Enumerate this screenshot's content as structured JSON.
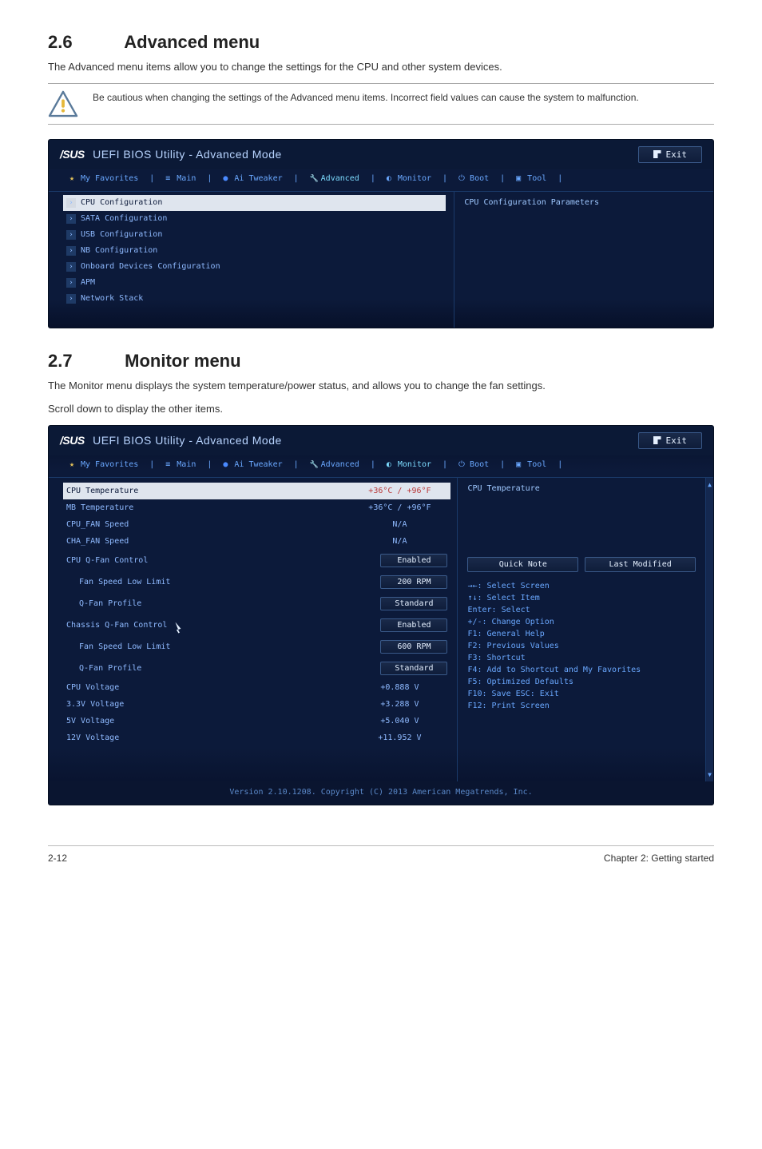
{
  "sections": {
    "advanced": {
      "num": "2.6",
      "title": "Advanced menu",
      "desc": "The Advanced menu items allow you to change the settings for the CPU and other system devices.",
      "caution": "Be cautious when changing the settings of the Advanced menu items. Incorrect field values can cause the system to malfunction."
    },
    "monitor": {
      "num": "2.7",
      "title": "Monitor menu",
      "desc": "The Monitor menu displays the system temperature/power status, and allows you to change the fan settings.",
      "scroll_hint": "Scroll down to display the other items."
    }
  },
  "bios": {
    "brand": "/SUS",
    "title": "UEFI BIOS Utility - Advanced Mode",
    "exit_label": "Exit",
    "tabs": [
      "My Favorites",
      "Main",
      "Ai Tweaker",
      "Advanced",
      "Monitor",
      "Boot",
      "Tool"
    ]
  },
  "advanced_panel": {
    "items": [
      "CPU Configuration",
      "SATA Configuration",
      "USB Configuration",
      "NB Configuration",
      "Onboard Devices Configuration",
      "APM",
      "Network Stack"
    ],
    "help": "CPU Configuration Parameters"
  },
  "monitor_panel": {
    "rows": [
      {
        "label": "CPU Temperature",
        "value": "+36°C / +96°F",
        "type": "sel"
      },
      {
        "label": "MB Temperature",
        "value": "+36°C / +96°F",
        "type": "text"
      },
      {
        "label": "CPU_FAN Speed",
        "value": "N/A",
        "type": "text"
      },
      {
        "label": "CHA_FAN Speed",
        "value": "N/A",
        "type": "text"
      },
      {
        "label": "CPU Q-Fan Control",
        "value": "Enabled",
        "type": "btn"
      },
      {
        "label": "Fan Speed Low Limit",
        "value": "200 RPM",
        "type": "btn",
        "indent": true
      },
      {
        "label": "Q-Fan Profile",
        "value": "Standard",
        "type": "btn",
        "indent": true
      },
      {
        "label": "Chassis Q-Fan Control",
        "value": "Enabled",
        "type": "btn",
        "cursor": true
      },
      {
        "label": "Fan Speed Low Limit",
        "value": "600 RPM",
        "type": "btn",
        "indent": true
      },
      {
        "label": "Q-Fan Profile",
        "value": "Standard",
        "type": "btn",
        "indent": true
      },
      {
        "label": "CPU Voltage",
        "value": "+0.888 V",
        "type": "text"
      },
      {
        "label": "3.3V Voltage",
        "value": "+3.288 V",
        "type": "text"
      },
      {
        "label": "5V Voltage",
        "value": "+5.040 V",
        "type": "text"
      },
      {
        "label": "12V Voltage",
        "value": "+11.952 V",
        "type": "text"
      }
    ],
    "right_heading": "CPU Temperature",
    "right_buttons": [
      "Quick Note",
      "Last Modified"
    ],
    "help_lines": [
      "→←: Select Screen",
      "↑↓: Select Item",
      "Enter: Select",
      "+/-: Change Option",
      "F1: General Help",
      "F2: Previous Values",
      "F3: Shortcut",
      "F4: Add to Shortcut and My Favorites",
      "F5: Optimized Defaults",
      "F10: Save  ESC: Exit",
      "F12: Print Screen"
    ],
    "version": "Version 2.10.1208. Copyright (C) 2013 American Megatrends, Inc."
  },
  "footer": {
    "page": "2-12",
    "chapter": "Chapter 2: Getting started"
  }
}
